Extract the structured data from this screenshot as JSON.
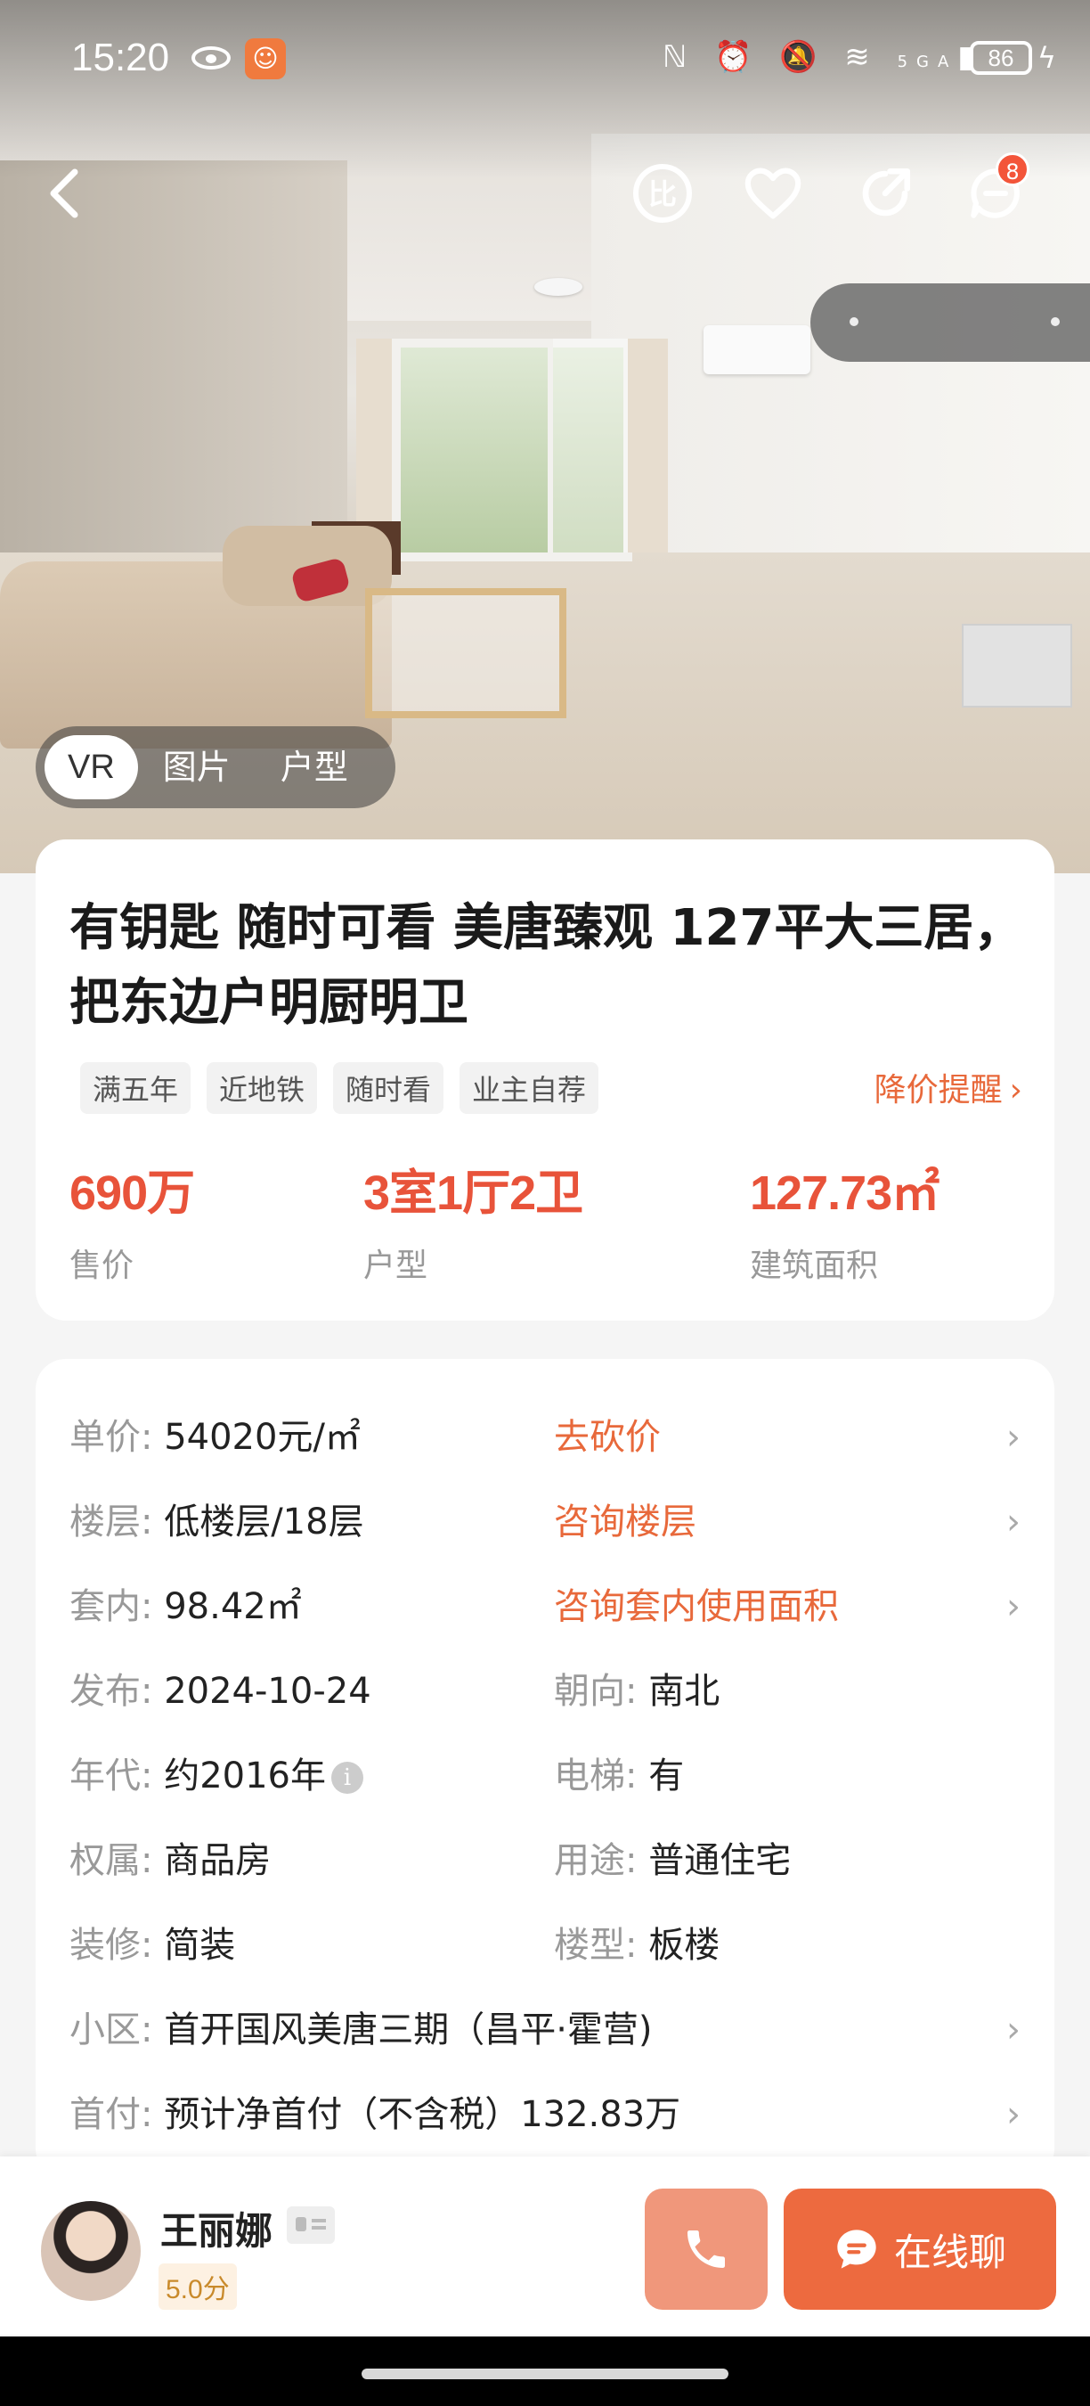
{
  "status_bar": {
    "time": "15:20",
    "battery": "86",
    "network": "5GA"
  },
  "nav": {
    "message_badge": "8"
  },
  "media_tabs": [
    {
      "label": "VR"
    },
    {
      "label": "图片"
    },
    {
      "label": "户型"
    }
  ],
  "summary": {
    "title": "有钥匙 随时可看 美唐臻观 127平大三居，把东边户明厨明卫",
    "tags": [
      "满五年",
      "近地铁",
      "随时看",
      "业主自荐"
    ],
    "price_alert": "降价提醒",
    "stats": [
      {
        "value": "690万",
        "label": "售价"
      },
      {
        "value": "3室1厅2卫",
        "label": "户型"
      },
      {
        "value": "127.73㎡",
        "label": "建筑面积"
      }
    ]
  },
  "details": {
    "unit_price": {
      "key": "单价:",
      "value": "54020元/㎡",
      "link": "去砍价"
    },
    "floor": {
      "key": "楼层:",
      "value": "低楼层/18层",
      "link": "咨询楼层"
    },
    "inner": {
      "key": "套内:",
      "value": "98.42㎡",
      "link": "咨询套内使用面积"
    },
    "published": {
      "key": "发布:",
      "value": "2024-10-24"
    },
    "orientation": {
      "key": "朝向:",
      "value": "南北"
    },
    "era": {
      "key": "年代:",
      "value": "约2016年"
    },
    "elevator": {
      "key": "电梯:",
      "value": "有"
    },
    "ownership": {
      "key": "权属:",
      "value": "商品房"
    },
    "usage": {
      "key": "用途:",
      "value": "普通住宅"
    },
    "decoration": {
      "key": "装修:",
      "value": "简装"
    },
    "building_type": {
      "key": "楼型:",
      "value": "板楼"
    },
    "community": {
      "key": "小区:",
      "value": "首开国风美唐三期（昌平·霍营)"
    },
    "down_payment": {
      "key": "首付:",
      "value": "预计净首付（不含税）132.83万"
    }
  },
  "agent": {
    "name": "王丽娜",
    "score": "5.0分",
    "chat_label": "在线聊"
  },
  "colors": {
    "accent": "#e8533a",
    "link": "#e8693b",
    "chat": "#ed6a3f",
    "call": "#f0977b"
  }
}
